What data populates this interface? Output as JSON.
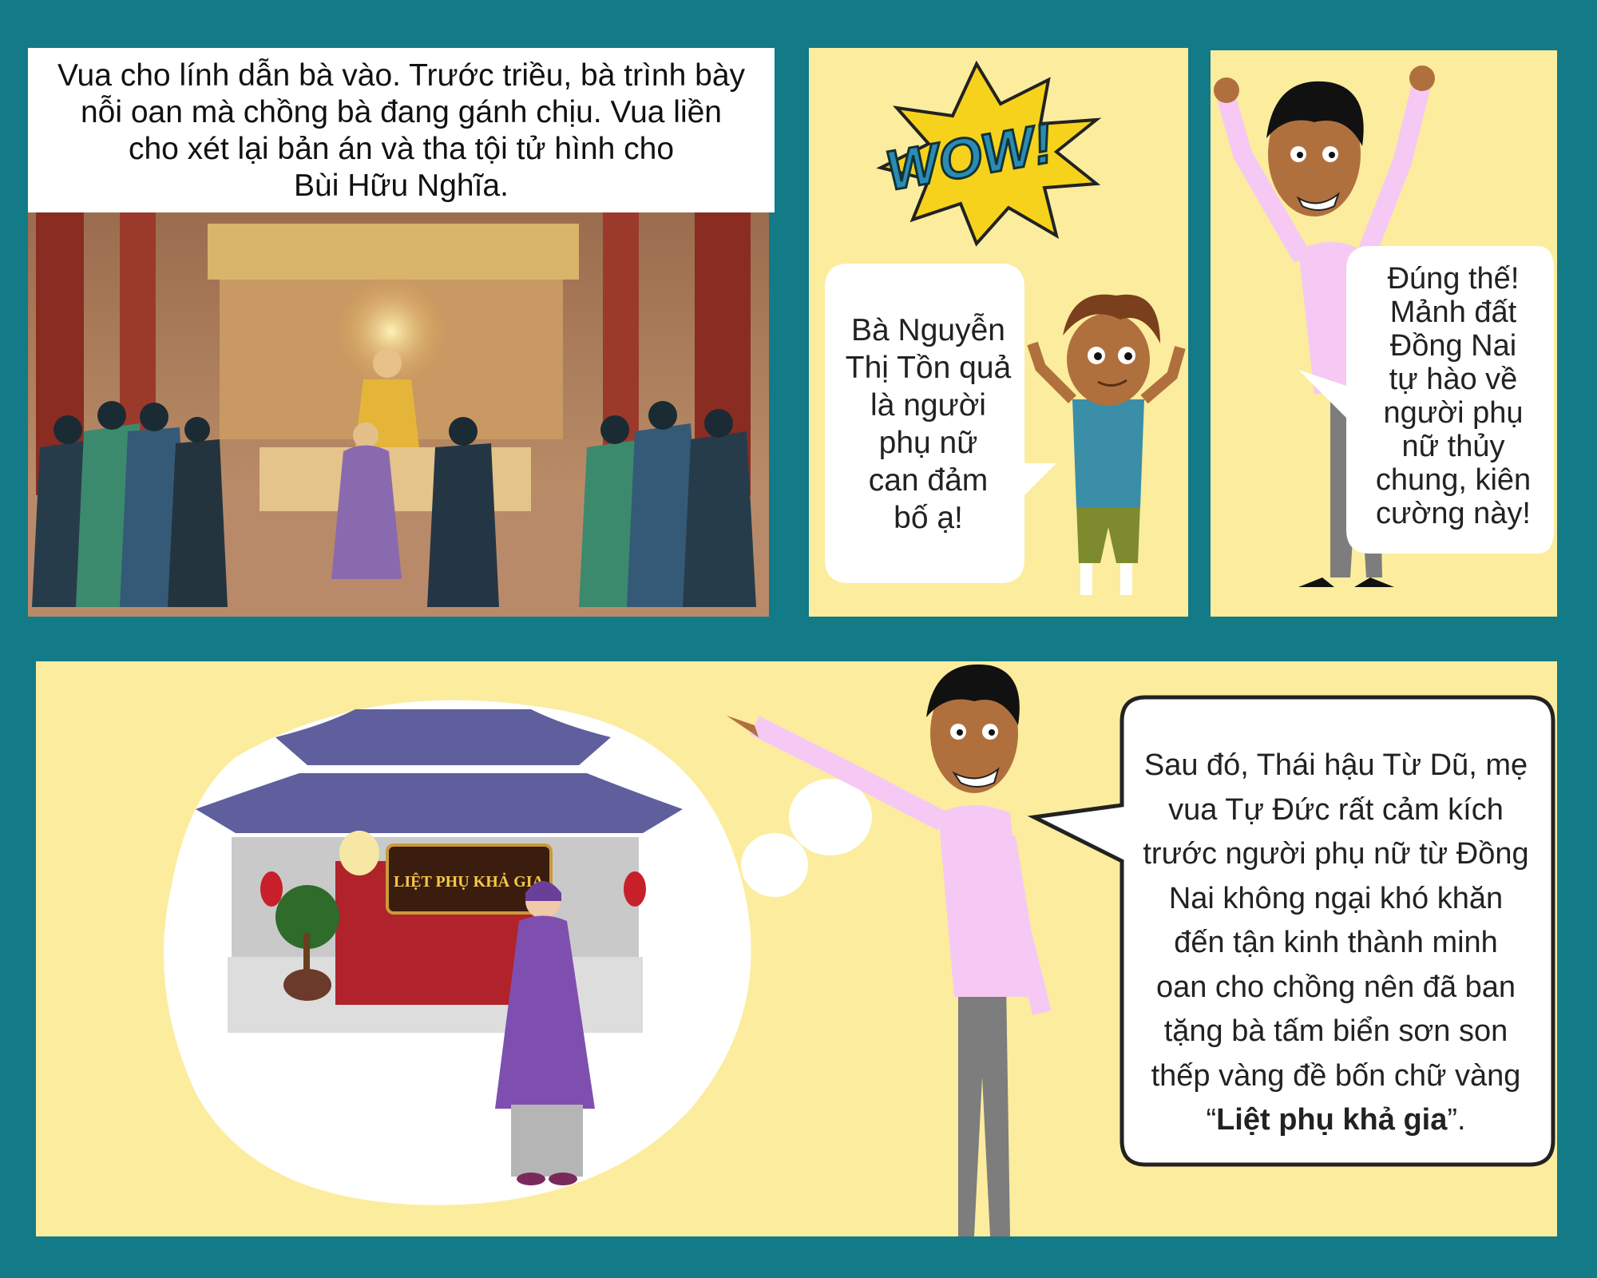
{
  "panel1": {
    "caption_lines": [
      "Vua cho lính dẫn bà vào. Trước triều, bà trình bày",
      "nỗi oan mà chồng bà đang gánh chịu. Vua liền",
      "cho xét lại bản án và tha tội tử hình cho",
      "Bùi Hữu Nghĩa."
    ]
  },
  "panel2": {
    "sfx": "WOW!",
    "speech_lines": [
      "Bà Nguyễn",
      "Thị Tồn quả",
      "là người",
      "phụ nữ",
      "can đảm",
      "bố ạ!"
    ]
  },
  "panel3": {
    "speech_lines": [
      "Đúng thế!",
      "Mảnh đất",
      "Đồng Nai",
      "tự hào về",
      "người phụ",
      "nữ thủy",
      "chung, kiên",
      "cường này!"
    ]
  },
  "panel4": {
    "sign_text": "LIỆT PHỤ KHẢ GIA",
    "speech_lines": [
      "Sau đó, Thái hậu Từ Dũ, mẹ",
      "vua Tự Đức rất cảm kích",
      "trước người phụ nữ từ Đồng",
      "Nai không ngại khó khăn",
      "đến tận kinh thành minh",
      "oan cho chồng nên đã ban",
      "tặng bà tấm biển sơn son",
      "thếp vàng đề bốn chữ vàng"
    ],
    "quote_open": "“",
    "quote_bold": "Liệt phụ khả gia",
    "quote_close": "”."
  }
}
